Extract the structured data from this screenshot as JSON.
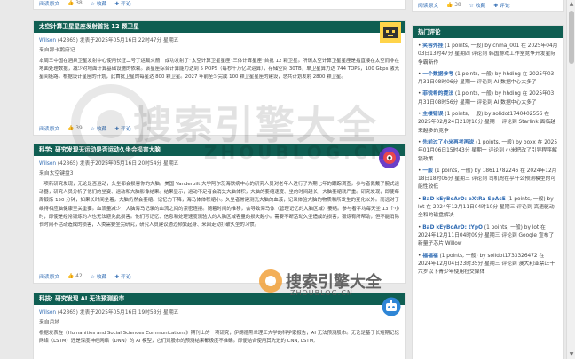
{
  "top_card": {
    "read_label": "阅读原文",
    "likes": "38",
    "collect": "收藏",
    "comment": "评论"
  },
  "posts": [
    {
      "title": "太空计算卫星星座发射首批 12 颗卫星",
      "author": "Wilson",
      "author_points": "(42865)",
      "meta_text": "发表于2025年05月16日 22时47分 星期五",
      "from": "来自那卡鹅府记",
      "body": "本周三中国在酒泉卫星发射中心使用长征二号丁运载火箭，成功发射了“太空计算卫星星座”三体计算星座”首批 12 颗卫星。所谓太空计算卫星星座是指直接在太空而非在地面处理数据，减少对地面计算基础设施的依赖。该星座综合计算能力达到 5 POPS（每秒千万亿次运算），存储空间 30TB，单卫星算力达 744 TOPS，100 Gbps 激光星间链路。根据设计星座的计划，此首批卫星的每星达 800 颗卫星。2027 年前至少完成 100 颗卫星星座的建设，总共计划发射 2800 颗卫星。",
      "likes": "39"
    },
    {
      "title": "科学: 研究发现无运动是否运动久坐会损害大脑",
      "author": "Wilson",
      "author_points": "(42865)",
      "meta_text": "发表于2025年05月16日 20时54分 星期五",
      "from": "来自太空键盘3",
      "body": "一项新研究发现，无论是否运动，久坐都会损害你的大脑。美国 Vanderbilt 大学阿尔茨海默病中心的研究人员对老年人进行了为期七年的跟踪调查，参与者佩戴了腕式运动器，研究人员分析了他们的坐姿、运动和大脑影像结果。结果显示，运动不足者会消失大脑体积，大脑的萎缩速度、坐的时间越长，大脑萎缩就严重。研究发现，即使每周锻炼 150 分钟，如果长时间坐着，大脑仍然会萎缩。记忆力下降，海马体体积缩小。久坐者常建测光大脑的血液，记录体验大脑的物质和所发生的变化以外。而远对于维持相应脑健康至关重要。血流量减少，大脑海马记录的血流之间的紧密连接。随着时间的推移，会导致海马体（管理记忆的大脑区域）萎缩。参与者平均每天坐 13 个小时，即使是经常锻炼的人也无法避免此损害。他们写记忆、信息和处理速度测验大的大脑区域容量的损失越小。需要不断活动久坐造成的损害，锻炼有所帮助，但不能消除长时间不活动造成的损害，人类需要坐完研究，研究人员建议通过频繁起身、来回走动打破久坐的习惯。",
      "likes": "42"
    },
    {
      "title": "科技: 研究发现 AI 无法预测股市",
      "author": "Wilson",
      "author_points": "(42865)",
      "meta_text": "发表于2025年05月16日 19时58分 星期五",
      "from": "来自月地",
      "body": "根据发表在《Humanities and Social Sciences Communications》期刊上的一项研究，伊朗德黑兰理工大学的科学家报告，AI 无法预测股市。无论是基于长短期记忆网络（LSTM）还是深度神经网络（DNN）的 AI 模型，它们对股市的预测结果都极度不准确。即便结合使用其先进的 CNN, LSTM,"
    }
  ],
  "sidebar": {
    "top_read": "阅读原文",
    "top_likes": "38",
    "top_collect": "收藏",
    "top_comment": "评论",
    "heading": "热门评论",
    "comments": [
      {
        "title": "笑容外挂",
        "text": " (1 points, 一般) by cnma_001 在 2025年04月03日13时47分 星期四 评论到 韩国游戏工作室竞争开发星际争霸新作"
      },
      {
        "title": "一个数据参考",
        "text": " (1 points, 一般) by hhding 在 2025年03月31日08时06分 星期一 评论到 AI 数据中心太多了"
      },
      {
        "title": "菲锐希的提法",
        "text": " (1 points, 一般) by hhding 在 2025年03月31日08时56分 星期一 评论到 AI 数据中心太多了"
      },
      {
        "title": "主楼错误",
        "text": " (1 points, 一般) by solidot1740402556 在 2025年02月24日21时10分 星期一 评论到 Starlink 面临越来越多的竞争"
      },
      {
        "title": "先前过了小米再考再说",
        "text": " (1 points, 一般) by ooxx 在 2025年01月06日15时43分 星期一 评论到 小米把改了引导程序解锁政策"
      },
      {
        "title": "一般",
        "text": " (1 points, 一般) by 18611782246 在 2024年12月18日18时06分 星期三 评论到 司机兜在乎什么预测模型的可能性较低"
      },
      {
        "title": "BaD kEyBoArD: eXtRa SpAcE",
        "text": " (1 points, 一般) by lot 在 2024年12月11日04时10分 星期三 评论到 高速驱动全和的磁盘解决"
      },
      {
        "title": "BaD kEyBoArD: tYpO",
        "text": " (1 points, 一般) by lot 在 2024年12月11日04时09分 星期三 评论到 Google 宣布了新量子芯片 Willow"
      },
      {
        "title": "福福福",
        "text": " (1 points, 一般) by solidot1733326472 在 2024年12月04日23时35分 星期三 评论到 澳大利亚禁止十六岁以下青少年使用社交媒体"
      }
    ]
  },
  "colors": {
    "header": "#0f5e52",
    "link": "#2f6bb3"
  },
  "watermark": {
    "brand": "搜索引擎大全",
    "domain": "ZHOUBLOG.CN"
  }
}
